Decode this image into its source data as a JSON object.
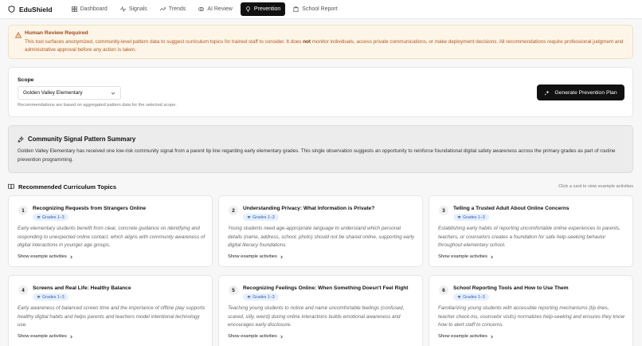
{
  "app": {
    "name": "EduShield"
  },
  "nav": [
    {
      "label": "Dashboard",
      "icon": "grid-icon"
    },
    {
      "label": "Signals",
      "icon": "pulse-icon"
    },
    {
      "label": "Trends",
      "icon": "trend-icon"
    },
    {
      "label": "AI Review",
      "icon": "brain-icon"
    },
    {
      "label": "Prevention",
      "icon": "bulb-icon",
      "active": true
    },
    {
      "label": "School Report",
      "icon": "building-icon"
    }
  ],
  "alert": {
    "title": "Human Review Required",
    "body_before": "This tool surfaces anonymized, community-level pattern data to suggest curriculum topics for trained staff to consider. It does ",
    "body_bold": "not",
    "body_after": " monitor individuals, access private communications, or make deployment decisions. All recommendations require professional judgment and administrative approval before any action is taken."
  },
  "scope": {
    "label": "Scope",
    "selected": "Golden Valley Elementary",
    "hint": "Recommendations are based on aggregated pattern data for the selected scope.",
    "generate_label": "Generate Prevention Plan"
  },
  "summary": {
    "title": "Community Signal Pattern Summary",
    "body": "Golden Valley Elementary has received one low-risk community signal from a parent tip line regarding early elementary grades. This single observation suggests an opportunity to reinforce foundational digital safety awareness across the primary grades as part of routine prevention programming."
  },
  "topics": {
    "title": "Recommended Curriculum Topics",
    "hint": "Click a card to view example activities",
    "show_label": "Show example activities",
    "items": [
      {
        "num": "1",
        "title": "Recognizing Requests from Strangers Online",
        "grades": "Grades 1–3",
        "desc": "Early elementary students benefit from clear, concrete guidance on identifying and responding to unexpected online contact, which aligns with community awareness of digital interactions in younger age groups."
      },
      {
        "num": "2",
        "title": "Understanding Privacy: What Information is Private?",
        "grades": "Grades 1–3",
        "desc": "Young students need age-appropriate language to understand which personal details (name, address, school, photo) should not be shared online, supporting early digital literacy foundations."
      },
      {
        "num": "3",
        "title": "Telling a Trusted Adult About Online Concerns",
        "grades": "Grades 1–3",
        "desc": "Establishing early habits of reporting uncomfortable online experiences to parents, teachers, or counselors creates a foundation for safe help-seeking behavior throughout elementary school."
      },
      {
        "num": "4",
        "title": "Screens and Real Life: Healthy Balance",
        "grades": "Grades 1–3",
        "desc": "Early awareness of balanced screen time and the importance of offline play supports healthy digital habits and helps parents and teachers model intentional technology use."
      },
      {
        "num": "5",
        "title": "Recognizing Feelings Online: When Something Doesn't Feel Right",
        "grades": "Grades 1–3",
        "desc": "Teaching young students to notice and name uncomfortable feelings (confused, scared, silly, weird) during online interactions builds emotional awareness and encourages early disclosure."
      },
      {
        "num": "6",
        "title": "School Reporting Tools and How to Use Them",
        "grades": "Grades 1–3",
        "desc": "Familiarizing young students with accessible reporting mechanisms (tip lines, teacher check-ins, counselor visits) normalizes help-seeking and ensures they know how to alert staff to concerns."
      }
    ]
  }
}
